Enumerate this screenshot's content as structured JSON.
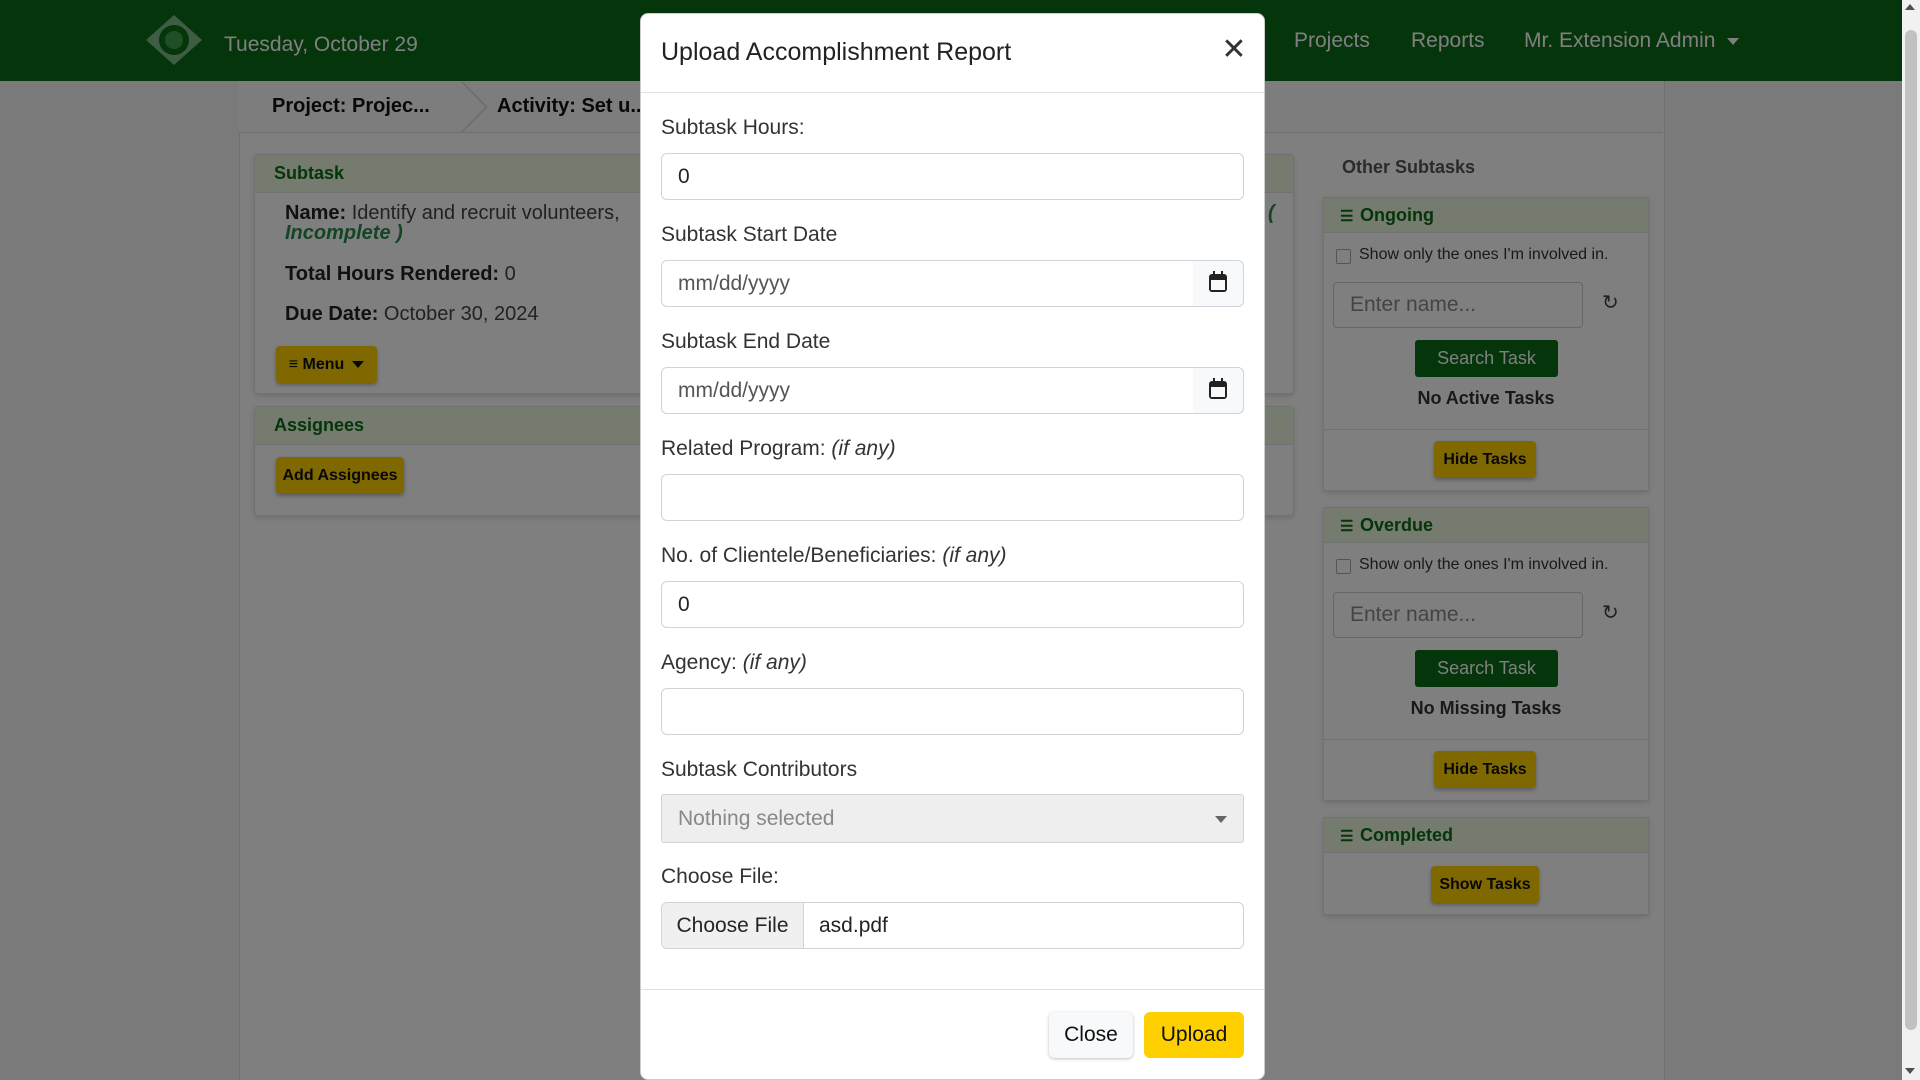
{
  "navbar": {
    "date": "Tuesday, October 29",
    "links": [
      "Projects",
      "Reports"
    ],
    "user": "Mr. Extension Admin"
  },
  "breadcrumb": {
    "project": "Project: Projec...",
    "activity": "Activity: Set u..."
  },
  "subtask": {
    "header": "Subtask",
    "name_label": "Name:",
    "name_value": "Identify and recruit volunteers,",
    "status_open": "(",
    "status": "Incomplete )",
    "hours_label": "Total Hours Rendered:",
    "hours_value": "0",
    "due_label": "Due Date:",
    "due_value": "October 30, 2024",
    "menu_label": "Menu"
  },
  "assignees": {
    "header": "Assignees",
    "add_label": "Add Assignees"
  },
  "other_subtasks": {
    "title": "Other Subtasks",
    "ongoing": {
      "header": "Ongoing",
      "checkbox_label": "Show only the ones I'm involved in.",
      "search_placeholder": "Enter name...",
      "search_button": "Search Task",
      "empty": "No Active Tasks",
      "toggle": "Hide Tasks"
    },
    "overdue": {
      "header": "Overdue",
      "checkbox_label": "Show only the ones I'm involved in.",
      "search_placeholder": "Enter name...",
      "search_button": "Search Task",
      "empty": "No Missing Tasks",
      "toggle": "Hide Tasks"
    },
    "completed": {
      "header": "Completed",
      "toggle": "Show Tasks"
    }
  },
  "modal": {
    "title": "Upload Accomplishment Report",
    "hours_label": "Subtask Hours:",
    "hours_value": "0",
    "start_label": "Subtask Start Date",
    "start_placeholder": "mm/dd/yyyy",
    "end_label": "Subtask End Date",
    "end_placeholder": "mm/dd/yyyy",
    "program_label": "Related Program:",
    "program_hint": "(if any)",
    "program_value": "",
    "clientele_label": "No. of Clientele/Beneficiaries:",
    "clientele_hint": "(if any)",
    "clientele_value": "0",
    "agency_label": "Agency:",
    "agency_hint": "(if any)",
    "agency_value": "",
    "contributors_label": "Subtask Contributors",
    "contributors_value": "Nothing selected",
    "file_label": "Choose File:",
    "file_button": "Choose File",
    "file_name": "asd.pdf",
    "close_button": "Close",
    "upload_button": "Upload"
  },
  "colors": {
    "navbar": "#0b6a14",
    "accent_yellow": "#ffd000",
    "card_header_bg": "#eaf6dd",
    "green_text": "#0b6a14"
  },
  "icons": [
    "logo-icon",
    "caret-down-icon",
    "list-icon",
    "refresh-icon",
    "close-icon",
    "calendar-icon"
  ]
}
